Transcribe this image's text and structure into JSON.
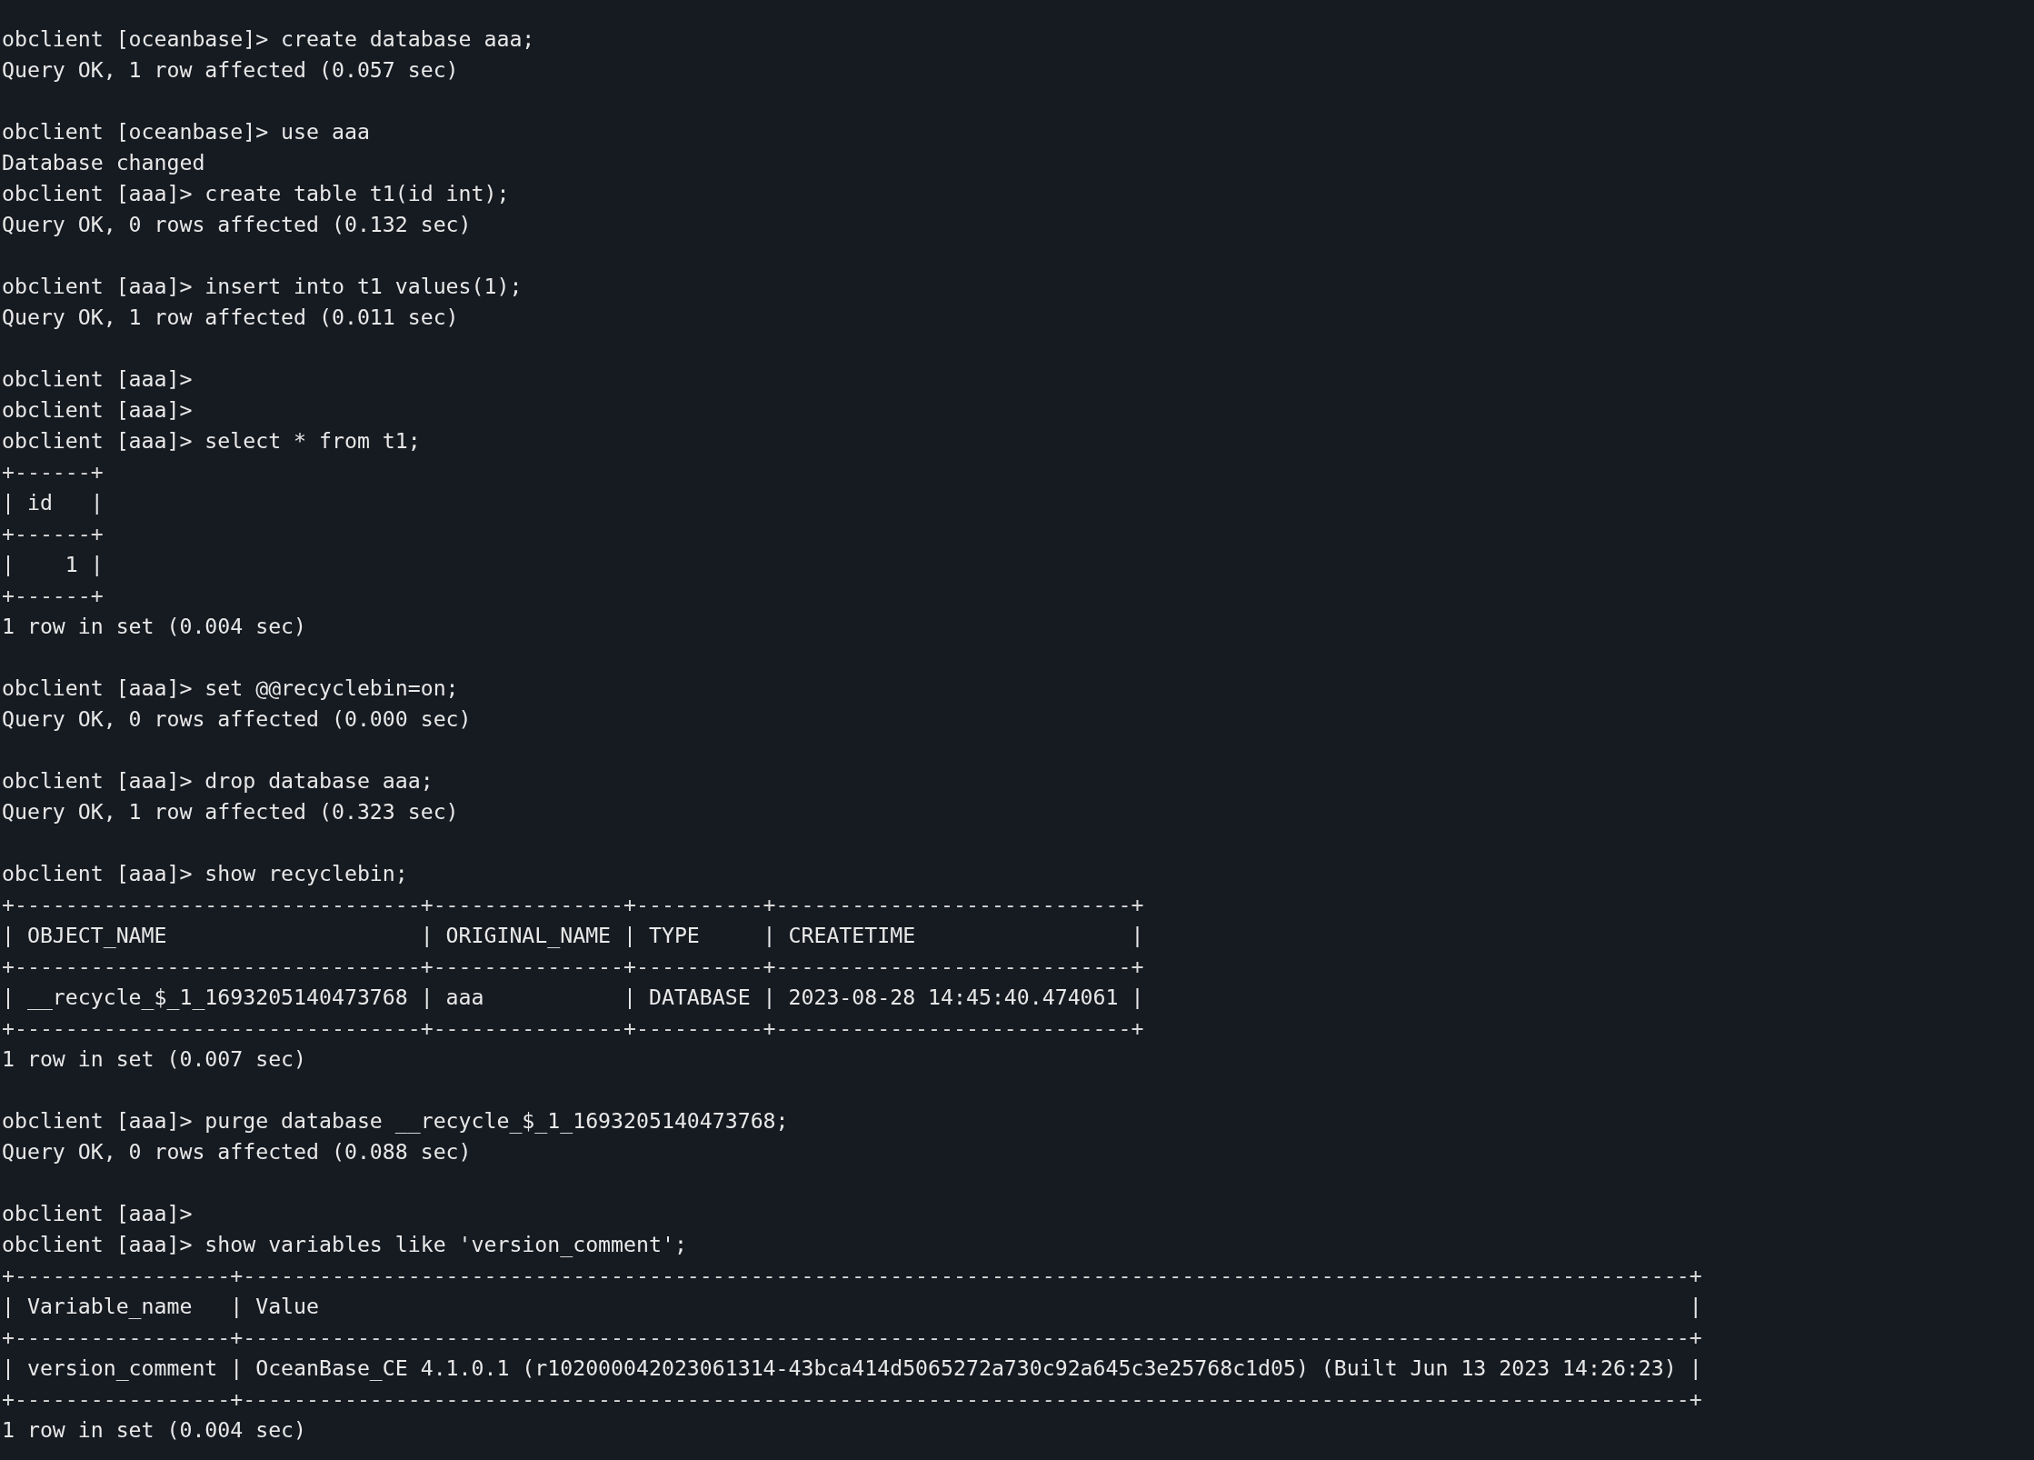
{
  "terminal": {
    "lines": [
      {
        "kind": "command",
        "text": "obclient [oceanbase]> create database aaa;"
      },
      {
        "kind": "output",
        "text": "Query OK, 1 row affected (0.057 sec)"
      },
      {
        "kind": "blank"
      },
      {
        "kind": "command",
        "text": "obclient [oceanbase]> use aaa"
      },
      {
        "kind": "output",
        "text": "Database changed"
      },
      {
        "kind": "command",
        "text": "obclient [aaa]> create table t1(id int);"
      },
      {
        "kind": "output",
        "text": "Query OK, 0 rows affected (0.132 sec)"
      },
      {
        "kind": "blank"
      },
      {
        "kind": "command",
        "text": "obclient [aaa]> insert into t1 values(1);"
      },
      {
        "kind": "output",
        "text": "Query OK, 1 row affected (0.011 sec)"
      },
      {
        "kind": "blank"
      },
      {
        "kind": "command",
        "text": "obclient [aaa]>"
      },
      {
        "kind": "command",
        "text": "obclient [aaa]>"
      },
      {
        "kind": "command",
        "text": "obclient [aaa]> select * from t1;"
      },
      {
        "kind": "border",
        "text": "+------+"
      },
      {
        "kind": "row",
        "text": "| id   |"
      },
      {
        "kind": "border",
        "text": "+------+"
      },
      {
        "kind": "row",
        "text": "|    1 |"
      },
      {
        "kind": "border",
        "text": "+------+"
      },
      {
        "kind": "output",
        "text": "1 row in set (0.004 sec)"
      },
      {
        "kind": "blank"
      },
      {
        "kind": "command",
        "text": "obclient [aaa]> set @@recyclebin=on;"
      },
      {
        "kind": "output",
        "text": "Query OK, 0 rows affected (0.000 sec)"
      },
      {
        "kind": "blank"
      },
      {
        "kind": "command",
        "text": "obclient [aaa]> drop database aaa;"
      },
      {
        "kind": "output",
        "text": "Query OK, 1 row affected (0.323 sec)"
      },
      {
        "kind": "blank"
      },
      {
        "kind": "command",
        "text": "obclient [aaa]> show recyclebin;"
      },
      {
        "kind": "border",
        "text": "+--------------------------------+---------------+----------+----------------------------+"
      },
      {
        "kind": "row",
        "text": "| OBJECT_NAME                    | ORIGINAL_NAME | TYPE     | CREATETIME                 |"
      },
      {
        "kind": "border",
        "text": "+--------------------------------+---------------+----------+----------------------------+"
      },
      {
        "kind": "row",
        "text": "| __recycle_$_1_1693205140473768 | aaa           | DATABASE | 2023-08-28 14:45:40.474061 |"
      },
      {
        "kind": "border",
        "text": "+--------------------------------+---------------+----------+----------------------------+"
      },
      {
        "kind": "output",
        "text": "1 row in set (0.007 sec)"
      },
      {
        "kind": "blank"
      },
      {
        "kind": "command",
        "text": "obclient [aaa]> purge database __recycle_$_1_1693205140473768;"
      },
      {
        "kind": "output",
        "text": "Query OK, 0 rows affected (0.088 sec)"
      },
      {
        "kind": "blank"
      },
      {
        "kind": "command",
        "text": "obclient [aaa]>"
      },
      {
        "kind": "command",
        "text": "obclient [aaa]> show variables like 'version_comment';"
      },
      {
        "kind": "border",
        "text": "+-----------------+------------------------------------------------------------------------------------------------------------------+"
      },
      {
        "kind": "row",
        "text": "| Variable_name   | Value                                                                                                            |"
      },
      {
        "kind": "border",
        "text": "+-----------------+------------------------------------------------------------------------------------------------------------------+"
      },
      {
        "kind": "row",
        "text": "| version_comment | OceanBase_CE 4.1.0.1 (r102000042023061314-43bca414d5065272a730c92a645c3e25768c1d05) (Built Jun 13 2023 14:26:23) |"
      },
      {
        "kind": "border",
        "text": "+-----------------+------------------------------------------------------------------------------------------------------------------+"
      },
      {
        "kind": "output",
        "text": "1 row in set (0.004 sec)"
      }
    ]
  }
}
